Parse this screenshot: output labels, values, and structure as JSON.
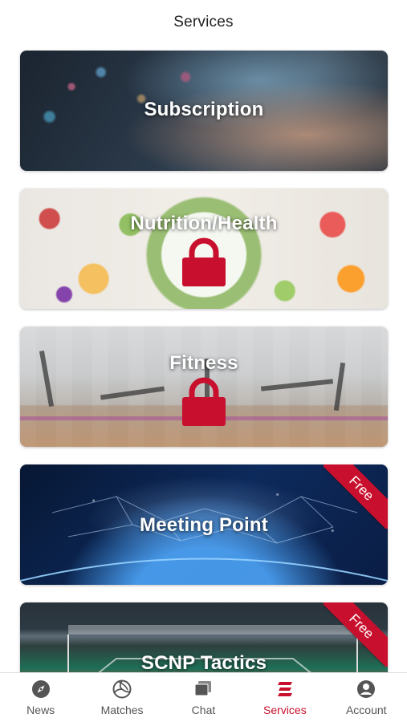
{
  "header": {
    "title": "Services"
  },
  "cards": [
    {
      "label": "Subscription",
      "locked": false,
      "badge": ""
    },
    {
      "label": "Nutrition/Health",
      "locked": true,
      "badge": ""
    },
    {
      "label": "Fitness",
      "locked": true,
      "badge": ""
    },
    {
      "label": "Meeting Point",
      "locked": false,
      "badge": "Free"
    },
    {
      "label": "SCNP Tactics",
      "locked": false,
      "badge": "Free"
    }
  ],
  "tabs": [
    {
      "label": "News",
      "icon": "compass-icon"
    },
    {
      "label": "Matches",
      "icon": "volleyball-icon"
    },
    {
      "label": "Chat",
      "icon": "chat-icon"
    },
    {
      "label": "Services",
      "icon": "services-icon",
      "active": true
    },
    {
      "label": "Account",
      "icon": "account-icon"
    }
  ],
  "colors": {
    "accent": "#c8102e",
    "lock": "#c8102e",
    "inactive": "#555555"
  }
}
